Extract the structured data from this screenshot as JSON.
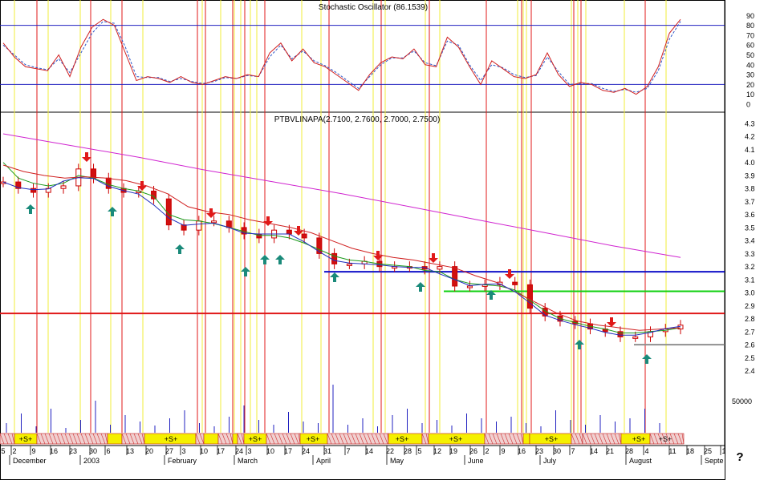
{
  "stoch_panel": {
    "title": "Stochastic Oscillator (86.1539)",
    "ticks": [
      "90",
      "80",
      "70",
      "60",
      "50",
      "40",
      "30",
      "20",
      "10",
      "0"
    ],
    "levels": [
      80,
      20
    ],
    "ylim": [
      0,
      95
    ]
  },
  "price_panel": {
    "title": "PTBVLINAPA(2.7100, 2.7600, 2.7000, 2.7500)",
    "ticks": [
      "4.3",
      "4.2",
      "4.1",
      "4.0",
      "3.9",
      "3.8",
      "3.7",
      "3.6",
      "3.5",
      "3.4",
      "3.3",
      "3.2",
      "3.1",
      "3.0",
      "2.9",
      "2.8",
      "2.7",
      "2.6",
      "2.5",
      "2.4"
    ],
    "volume_tick": "50000",
    "ylim": [
      2.35,
      4.35
    ]
  },
  "signal_bar": {
    "labels": [
      "+S+",
      "+S+",
      "+S+",
      "+S+",
      "+S+",
      "+S+",
      "+S+",
      "+S+",
      "+S+"
    ]
  },
  "date_axis": {
    "days": [
      "5",
      "2",
      "9",
      "16",
      "23",
      "30",
      "6",
      "13",
      "20",
      "27",
      "3",
      "10",
      "17",
      "24",
      "3",
      "10",
      "17",
      "24",
      "31",
      "7",
      "14",
      "22",
      "28",
      "5",
      "12",
      "19",
      "26",
      "2",
      "9",
      "16",
      "23",
      "30",
      "7",
      "14",
      "21",
      "28",
      "4",
      "11",
      "18",
      "25",
      "1"
    ],
    "months": [
      "December",
      "2003",
      "February",
      "March",
      "April",
      "May",
      "June",
      "July",
      "August",
      "Septe"
    ],
    "help_glyph": "?"
  },
  "chart_data": [
    {
      "type": "line",
      "title": "Stochastic Oscillator (86.1539)",
      "xlabel": "",
      "ylabel": "",
      "x_range": [
        "2002-12-05",
        "2003-08-24"
      ],
      "ylim": [
        0,
        95
      ],
      "reference_lines": [
        80,
        20
      ],
      "series": [
        {
          "values": [
            62,
            48,
            38,
            36,
            34,
            50,
            28,
            58,
            78,
            86,
            80,
            52,
            24,
            28,
            26,
            22,
            28,
            22,
            20,
            24,
            28,
            26,
            30,
            28,
            52,
            62,
            44,
            56,
            42,
            38,
            30,
            22,
            14,
            30,
            42,
            48,
            46,
            56,
            40,
            38,
            68,
            58,
            38,
            20,
            44,
            36,
            28,
            26,
            30,
            52,
            30,
            18,
            22,
            20,
            14,
            12,
            16,
            10,
            18,
            38,
            72,
            86
          ]
        },
        {
          "values": [
            60,
            50,
            40,
            37,
            35,
            46,
            32,
            52,
            72,
            84,
            82,
            58,
            28,
            27,
            27,
            23,
            26,
            23,
            21,
            23,
            27,
            26,
            29,
            28,
            48,
            60,
            46,
            54,
            44,
            39,
            32,
            24,
            16,
            28,
            40,
            47,
            47,
            54,
            42,
            39,
            64,
            60,
            40,
            24,
            40,
            37,
            30,
            27,
            29,
            48,
            33,
            20,
            21,
            21,
            16,
            13,
            15,
            12,
            16,
            34,
            66,
            84
          ]
        }
      ]
    },
    {
      "type": "line",
      "title": "PTBVLINAPA(2.7100, 2.7600, 2.7000, 2.7500)",
      "xlabel": "",
      "ylabel": "",
      "x_range": [
        "2002-12-05",
        "2003-08-24"
      ],
      "ylim": [
        2.35,
        4.35
      ],
      "reference_lines": [
        3.16,
        3.01,
        2.84,
        2.6
      ],
      "series": [
        {
          "values": [
            3.85,
            3.8,
            3.77,
            3.8,
            3.82,
            3.95,
            3.88,
            3.8,
            3.77,
            3.78,
            3.72,
            3.52,
            3.48,
            3.55,
            3.55,
            3.5,
            3.45,
            3.42,
            3.48,
            3.45,
            3.42,
            3.3,
            3.22,
            3.22,
            3.24,
            3.2,
            3.2,
            3.2,
            3.18,
            3.2,
            3.05,
            3.05,
            3.06,
            3.08,
            3.06,
            2.88,
            2.82,
            2.78,
            2.76,
            2.72,
            2.7,
            2.66,
            2.66,
            2.7,
            2.72,
            2.75
          ]
        },
        {
          "values": [
            4.0,
            3.88,
            3.84,
            3.82,
            3.84,
            3.9,
            3.88,
            3.83,
            3.8,
            3.78,
            3.74,
            3.6,
            3.56,
            3.55,
            3.53,
            3.5,
            3.47,
            3.44,
            3.44,
            3.42,
            3.38,
            3.33,
            3.28,
            3.25,
            3.24,
            3.22,
            3.21,
            3.2,
            3.17,
            3.16,
            3.1,
            3.07,
            3.06,
            3.05,
            3.02,
            2.94,
            2.86,
            2.8,
            2.77,
            2.74,
            2.72,
            2.69,
            2.69,
            2.7,
            2.71,
            2.73
          ]
        },
        {
          "values": [
            3.98,
            3.93,
            3.9,
            3.88,
            3.89,
            3.88,
            3.86,
            3.82,
            3.76,
            3.66,
            3.62,
            3.6,
            3.56,
            3.53,
            3.5,
            3.46,
            3.4,
            3.34,
            3.3,
            3.27,
            3.25,
            3.22,
            3.19,
            3.13,
            3.08,
            3.0,
            2.92,
            2.84,
            2.78,
            2.75,
            2.73,
            2.71,
            2.72,
            2.73
          ]
        },
        {
          "values": [
            4.22,
            4.13,
            4.04,
            3.94,
            3.85,
            3.76,
            3.66,
            3.56,
            3.46,
            3.36,
            3.27
          ]
        }
      ]
    }
  ]
}
